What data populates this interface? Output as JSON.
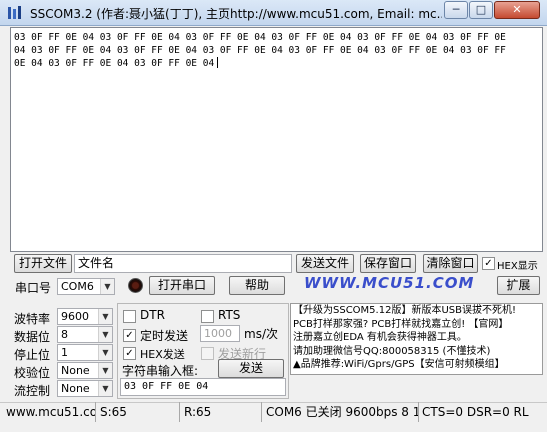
{
  "window": {
    "title": "SSCOM3.2 (作者:聂小猛(丁丁), 主页http://www.mcu51.com,  Email: mc...",
    "min_label": "─",
    "max_label": "□",
    "close_label": "✕"
  },
  "receive": {
    "text": "03 0F FF 0E 04 03 0F FF 0E 04 03 0F FF 0E 04 03 0F FF 0E 04 03 0F FF 0E 04 03 0F FF 0E 04 03 0F FF 0E 04 03 0F FF 0E 04 03 0F FF 0E 04 03 0F FF 0E 04 03 0F FF 0E 04 03 0F FF 0E 04 03 0F FF 0E 04 03 0F FF 0E 04"
  },
  "file_row": {
    "open_file_label": "打开文件",
    "file_name_value": "文件名",
    "send_file_label": "发送文件",
    "save_window_label": "保存窗口",
    "clear_window_label": "清除窗口",
    "hex_display_label": "HEX显示"
  },
  "port_row": {
    "port_label": "串口号",
    "port_value": "COM6",
    "open_port_label": "打开串口",
    "help_label": "帮助",
    "website_text": "WWW.MCU51.COM",
    "expand_label": "扩展"
  },
  "settings": {
    "baud_label": "波特率",
    "baud_value": "9600",
    "databits_label": "数据位",
    "databits_value": "8",
    "stopbits_label": "停止位",
    "stopbits_value": "1",
    "parity_label": "校验位",
    "parity_value": "None",
    "flow_label": "流控制",
    "flow_value": "None"
  },
  "send_options": {
    "dtr_label": "DTR",
    "rts_label": "RTS",
    "timed_send_label": "定时发送",
    "interval_value": "1000",
    "interval_unit": "ms/次",
    "hex_send_label": "HEX发送",
    "send_newline_label": "发送新行",
    "input_label": "字符串输入框:",
    "send_label": "发送",
    "send_text": "03 0F FF 0E 04"
  },
  "ad": {
    "lines": [
      "【升级为SSCOM5.12版】新版本USB误拔不死机!",
      "PCB打样那家强? PCB打样就找嘉立创! 【官网】",
      "注册嘉立创EDA 有机会获得神器工具。",
      "请加助理微信号QQ:800058315 (不懂技术)",
      "▲品牌推荐:WiFi/Gprs/GPS【安信可射频模组】"
    ]
  },
  "status": {
    "website": "www.mcu51.com",
    "sent": "S:65",
    "received": "R:65",
    "port_state": "COM6 已关闭  9600bps  8  1  None  None",
    "signals": "CTS=0 DSR=0 RL"
  }
}
